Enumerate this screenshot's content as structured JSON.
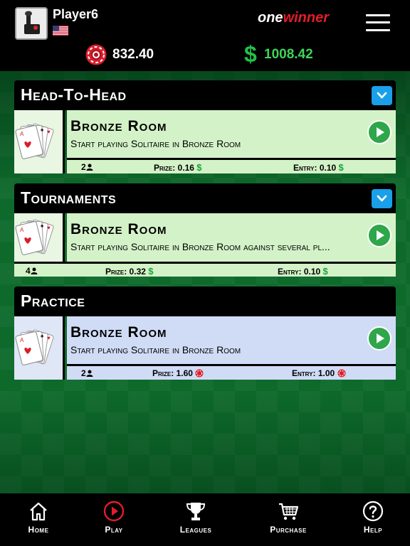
{
  "header": {
    "username": "Player6",
    "brand_one": "one",
    "brand_winner": "winner",
    "chip_balance": "832.40",
    "cash_symbol": "$",
    "cash_balance": "1008.42"
  },
  "sections": [
    {
      "title": "Head-To-Head",
      "collapsible": true,
      "room": {
        "name": "Bronze Room",
        "description": "Start playing Solitaire in Bronze Room",
        "players": "2",
        "prize_label": "Prize: 0.16",
        "entry_label": "Entry: 0.10",
        "currency": "cash"
      }
    },
    {
      "title": "Tournaments",
      "collapsible": true,
      "room": {
        "name": "Bronze Room",
        "description": "Start playing Solitaire in Bronze Room against several pl...",
        "players": "4",
        "prize_label": "Prize: 0.32",
        "entry_label": "Entry: 0.10",
        "currency": "cash"
      }
    },
    {
      "title": "Practice",
      "collapsible": false,
      "room": {
        "name": "Bronze Room",
        "description": "Start playing Solitaire in Bronze Room",
        "players": "2",
        "prize_label": "Prize: 1.60",
        "entry_label": "Entry: 1.00",
        "currency": "chips"
      }
    }
  ],
  "nav": [
    {
      "label": "Home",
      "icon": "house-icon"
    },
    {
      "label": "Play",
      "icon": "play-circle-icon",
      "active": true
    },
    {
      "label": "Leagues",
      "icon": "trophy-icon"
    },
    {
      "label": "Purchase",
      "icon": "cart-icon"
    },
    {
      "label": "Help",
      "icon": "question-circle-icon"
    }
  ],
  "colors": {
    "accent_red": "#e31c2a",
    "cash_green": "#3fd45a",
    "info_blue": "#1aa0e8",
    "felt_green": "#0d6a2b",
    "cash_room": "#d4f2c8",
    "practice_room": "#d0dcf6"
  }
}
